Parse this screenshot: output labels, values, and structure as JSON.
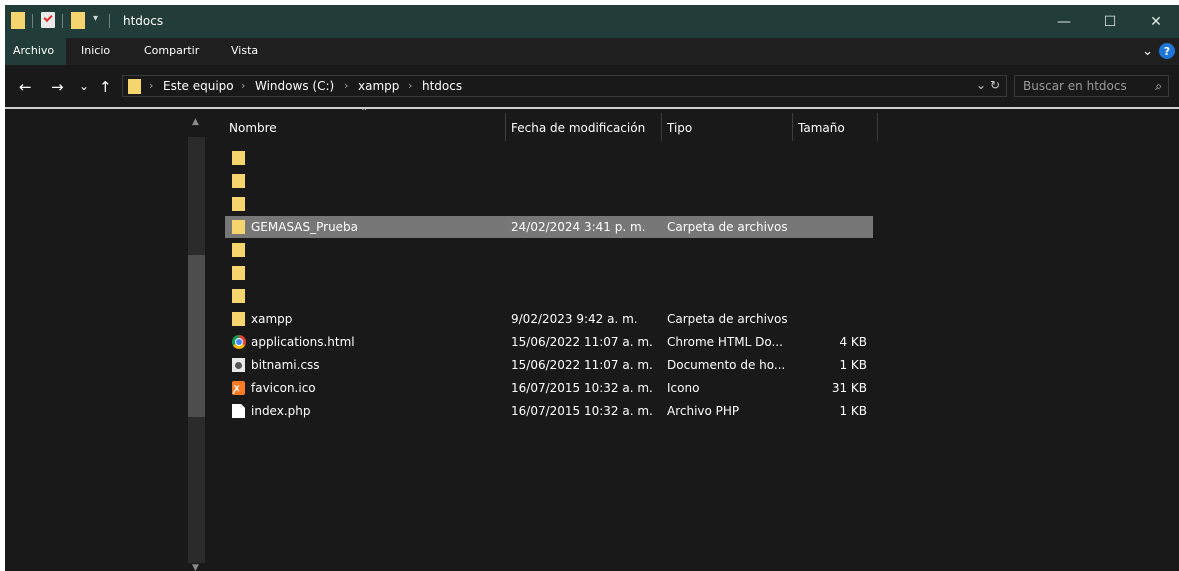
{
  "window": {
    "title": "htdocs",
    "controls": {
      "minimize": "—",
      "maximize": "☐",
      "close": "✕"
    }
  },
  "ribbon": {
    "tabs": [
      "Archivo",
      "Inicio",
      "Compartir",
      "Vista"
    ],
    "active_tab": "Archivo",
    "expand_icon": "⌄",
    "help_label": "?"
  },
  "navigation": {
    "back": "←",
    "forward": "→",
    "recent": "⌄",
    "up": "↑"
  },
  "address_bar": {
    "crumbs": [
      "Este equipo",
      "Windows (C:)",
      "xampp",
      "htdocs"
    ],
    "separator": "›",
    "dropdown_icon": "⌄",
    "refresh_icon": "↻"
  },
  "search": {
    "placeholder": "Buscar en htdocs",
    "icon": "⌕"
  },
  "columns": {
    "name": "Nombre",
    "date": "Fecha de modificación",
    "type": "Tipo",
    "size": "Tamaño"
  },
  "files": [
    {
      "icon": "folder",
      "name": "",
      "date": "",
      "type": "",
      "size": ""
    },
    {
      "icon": "folder",
      "name": "",
      "date": "",
      "type": "",
      "size": ""
    },
    {
      "icon": "folder",
      "name": "",
      "date": "",
      "type": "",
      "size": ""
    },
    {
      "icon": "folder",
      "name": "GEMASAS_Prueba",
      "date": "24/02/2024 3:41 p. m.",
      "type": "Carpeta de archivos",
      "size": "",
      "selected": true
    },
    {
      "icon": "folder",
      "name": "",
      "date": "",
      "type": "",
      "size": ""
    },
    {
      "icon": "folder",
      "name": "",
      "date": "",
      "type": "",
      "size": ""
    },
    {
      "icon": "folder",
      "name": "",
      "date": "",
      "type": "",
      "size": ""
    },
    {
      "icon": "folder",
      "name": "xampp",
      "date": "9/02/2023 9:42 a. m.",
      "type": "Carpeta de archivos",
      "size": ""
    },
    {
      "icon": "chrome",
      "name": "applications.html",
      "date": "15/06/2022 11:07 a. m.",
      "type": "Chrome HTML Do...",
      "size": "4 KB"
    },
    {
      "icon": "css",
      "name": "bitnami.css",
      "date": "15/06/2022 11:07 a. m.",
      "type": "Documento de ho...",
      "size": "1 KB"
    },
    {
      "icon": "xampp",
      "name": "favicon.ico",
      "date": "16/07/2015 10:32 a. m.",
      "type": "Icono",
      "size": "31 KB"
    },
    {
      "icon": "file",
      "name": "index.php",
      "date": "16/07/2015 10:32 a. m.",
      "type": "Archivo PHP",
      "size": "1 KB"
    }
  ],
  "colors": {
    "titlebar": "#223c39",
    "folder": "#f6d46e",
    "selection": "#777777",
    "background": "#191919"
  }
}
